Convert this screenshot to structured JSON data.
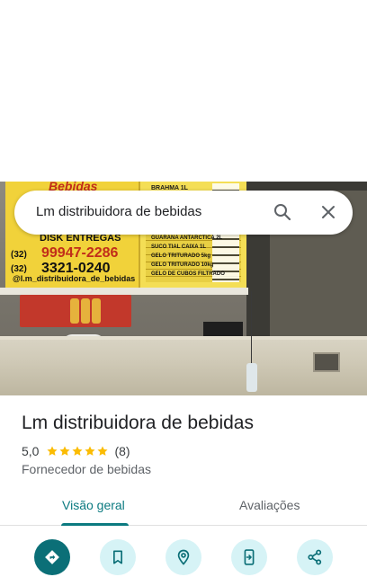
{
  "search": {
    "query": "Lm distribuidora de bebidas"
  },
  "photo": {
    "banner_title": "Bebidas",
    "banner_disk": "DISK ENTREGAS",
    "banner_code1": "(32)",
    "banner_phone1": "99947-2286",
    "banner_code2": "(32)",
    "banner_phone2": "3321-0240",
    "banner_instagram": "@l.m_distribuidora_de_bebidas",
    "price_brahma": "BRAHMA 1L",
    "price_items": [
      "GUARANA ANTARCTICA 2L",
      "SUCO TIAL CAIXA 1L",
      "GELO TRITURADO 5kg",
      "GELO TRITURADO 10kg",
      "GELO DE CUBOS FILTRADO"
    ]
  },
  "place": {
    "name": "Lm distribuidora de bebidas",
    "rating": "5,0",
    "stars": 5,
    "review_count": "(8)",
    "category": "Fornecedor de bebidas"
  },
  "tabs": [
    {
      "label": "Visão geral",
      "active": true
    },
    {
      "label": "Avaliações",
      "active": false
    }
  ],
  "actions": [
    {
      "icon": "directions-icon",
      "primary": true
    },
    {
      "icon": "bookmark-icon",
      "primary": false
    },
    {
      "icon": "nearby-icon",
      "primary": false
    },
    {
      "icon": "send-to-phone-icon",
      "primary": false
    },
    {
      "icon": "share-icon",
      "primary": false
    }
  ],
  "colors": {
    "accent": "#0b7a80",
    "primary_button": "#0b6f77",
    "secondary_button": "#d6f3f6",
    "star": "#fbbc04"
  }
}
